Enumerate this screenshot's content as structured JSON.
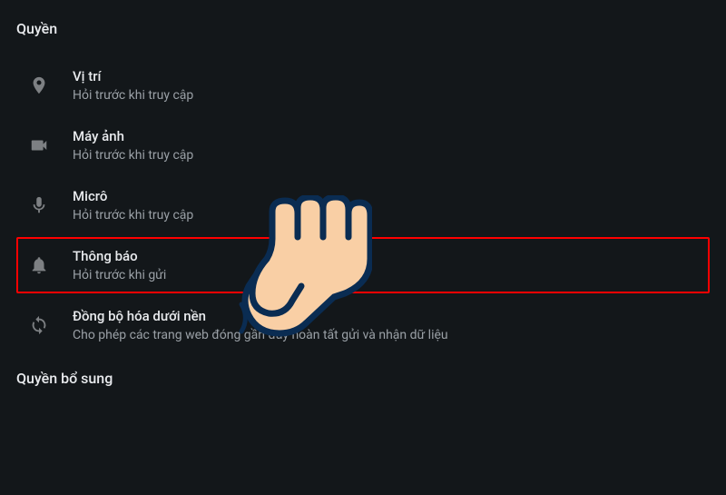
{
  "sections": {
    "primary_header": "Quyền",
    "secondary_header": "Quyền bổ sung"
  },
  "permissions": [
    {
      "id": "location",
      "title": "Vị trí",
      "subtitle": "Hỏi trước khi truy cập",
      "highlighted": false
    },
    {
      "id": "camera",
      "title": "Máy ảnh",
      "subtitle": "Hỏi trước khi truy cập",
      "highlighted": false
    },
    {
      "id": "microphone",
      "title": "Micrô",
      "subtitle": "Hỏi trước khi truy cập",
      "highlighted": false
    },
    {
      "id": "notifications",
      "title": "Thông báo",
      "subtitle": "Hỏi trước khi gửi",
      "highlighted": true
    },
    {
      "id": "background-sync",
      "title": "Đồng bộ hóa dưới nền",
      "subtitle": "Cho phép các trang web đóng gần đây hoàn tất gửi và nhận dữ liệu",
      "highlighted": false
    }
  ],
  "annotation": {
    "hand_visible": true,
    "highlight_color": "#ff0000",
    "hand_fill": "#f9cfa5",
    "hand_stroke": "#0a2c52"
  }
}
